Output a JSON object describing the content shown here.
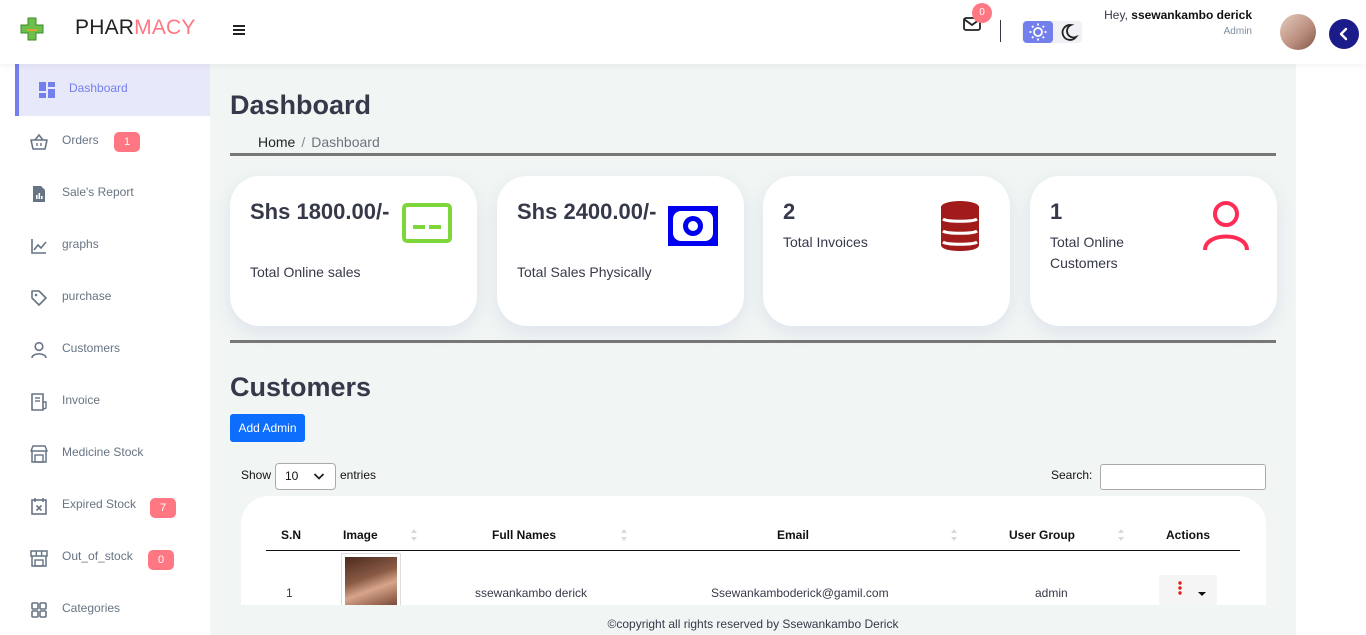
{
  "brand": {
    "name_main": "PHAR",
    "name_accent": "MACY"
  },
  "header": {
    "mail_count": "0",
    "greeting": "Hey,",
    "username": "ssewankambo derick",
    "role": "Admin"
  },
  "sidebar": {
    "items": [
      {
        "label": "Dashboard",
        "icon": "dashboard-icon",
        "active": true
      },
      {
        "label": "Orders",
        "icon": "basket-icon",
        "badge": "1"
      },
      {
        "label": "Sale's Report",
        "icon": "report-icon"
      },
      {
        "label": "graphs",
        "icon": "line-chart-icon"
      },
      {
        "label": "purchase",
        "icon": "tag-icon"
      },
      {
        "label": "Customers",
        "icon": "person-icon"
      },
      {
        "label": "Invoice",
        "icon": "invoice-icon"
      },
      {
        "label": "Medicine Stock",
        "icon": "store-icon"
      },
      {
        "label": "Expired Stock",
        "icon": "calendar-x-icon",
        "badge": "7"
      },
      {
        "label": "Out_of_stock",
        "icon": "shop-icon",
        "badge": "0"
      },
      {
        "label": "Categories",
        "icon": "grid-icon"
      }
    ]
  },
  "page": {
    "title": "Dashboard",
    "breadcrumb": {
      "home": "Home",
      "current": "Dashboard"
    }
  },
  "cards": [
    {
      "value": "Shs 1800.00/-",
      "caption": "Total Online sales",
      "icon": "card-icon",
      "color": "#7dd63a"
    },
    {
      "value": "Shs 2400.00/-",
      "caption": "Total Sales Physically",
      "icon": "cash-icon",
      "color": "#0000ee"
    },
    {
      "value": "2",
      "caption": "Total Invoices",
      "icon": "database-icon",
      "color": "#a11b1b"
    },
    {
      "value": "1",
      "caption": "Total Online Customers",
      "icon": "user-icon",
      "color": "#ff2d55"
    }
  ],
  "customers": {
    "title": "Customers",
    "add_button": "Add Admin",
    "show_label": "Show",
    "page_size": "10",
    "entries_label": "entries",
    "search_label": "Search:",
    "columns": [
      "S.N",
      "Image",
      "Full Names",
      "Email",
      "User Group",
      "Actions"
    ],
    "rows": [
      {
        "sn": "1",
        "name": "ssewankambo derick",
        "email": "Ssewankamboderick@gamil.com",
        "group": "admin"
      }
    ]
  },
  "footer": {
    "text": "©copyright all rights reserved by Ssewankambo Derick"
  },
  "colors": {
    "primary": "#7380ec",
    "danger": "#ff7782",
    "button": "#0d6efd"
  }
}
